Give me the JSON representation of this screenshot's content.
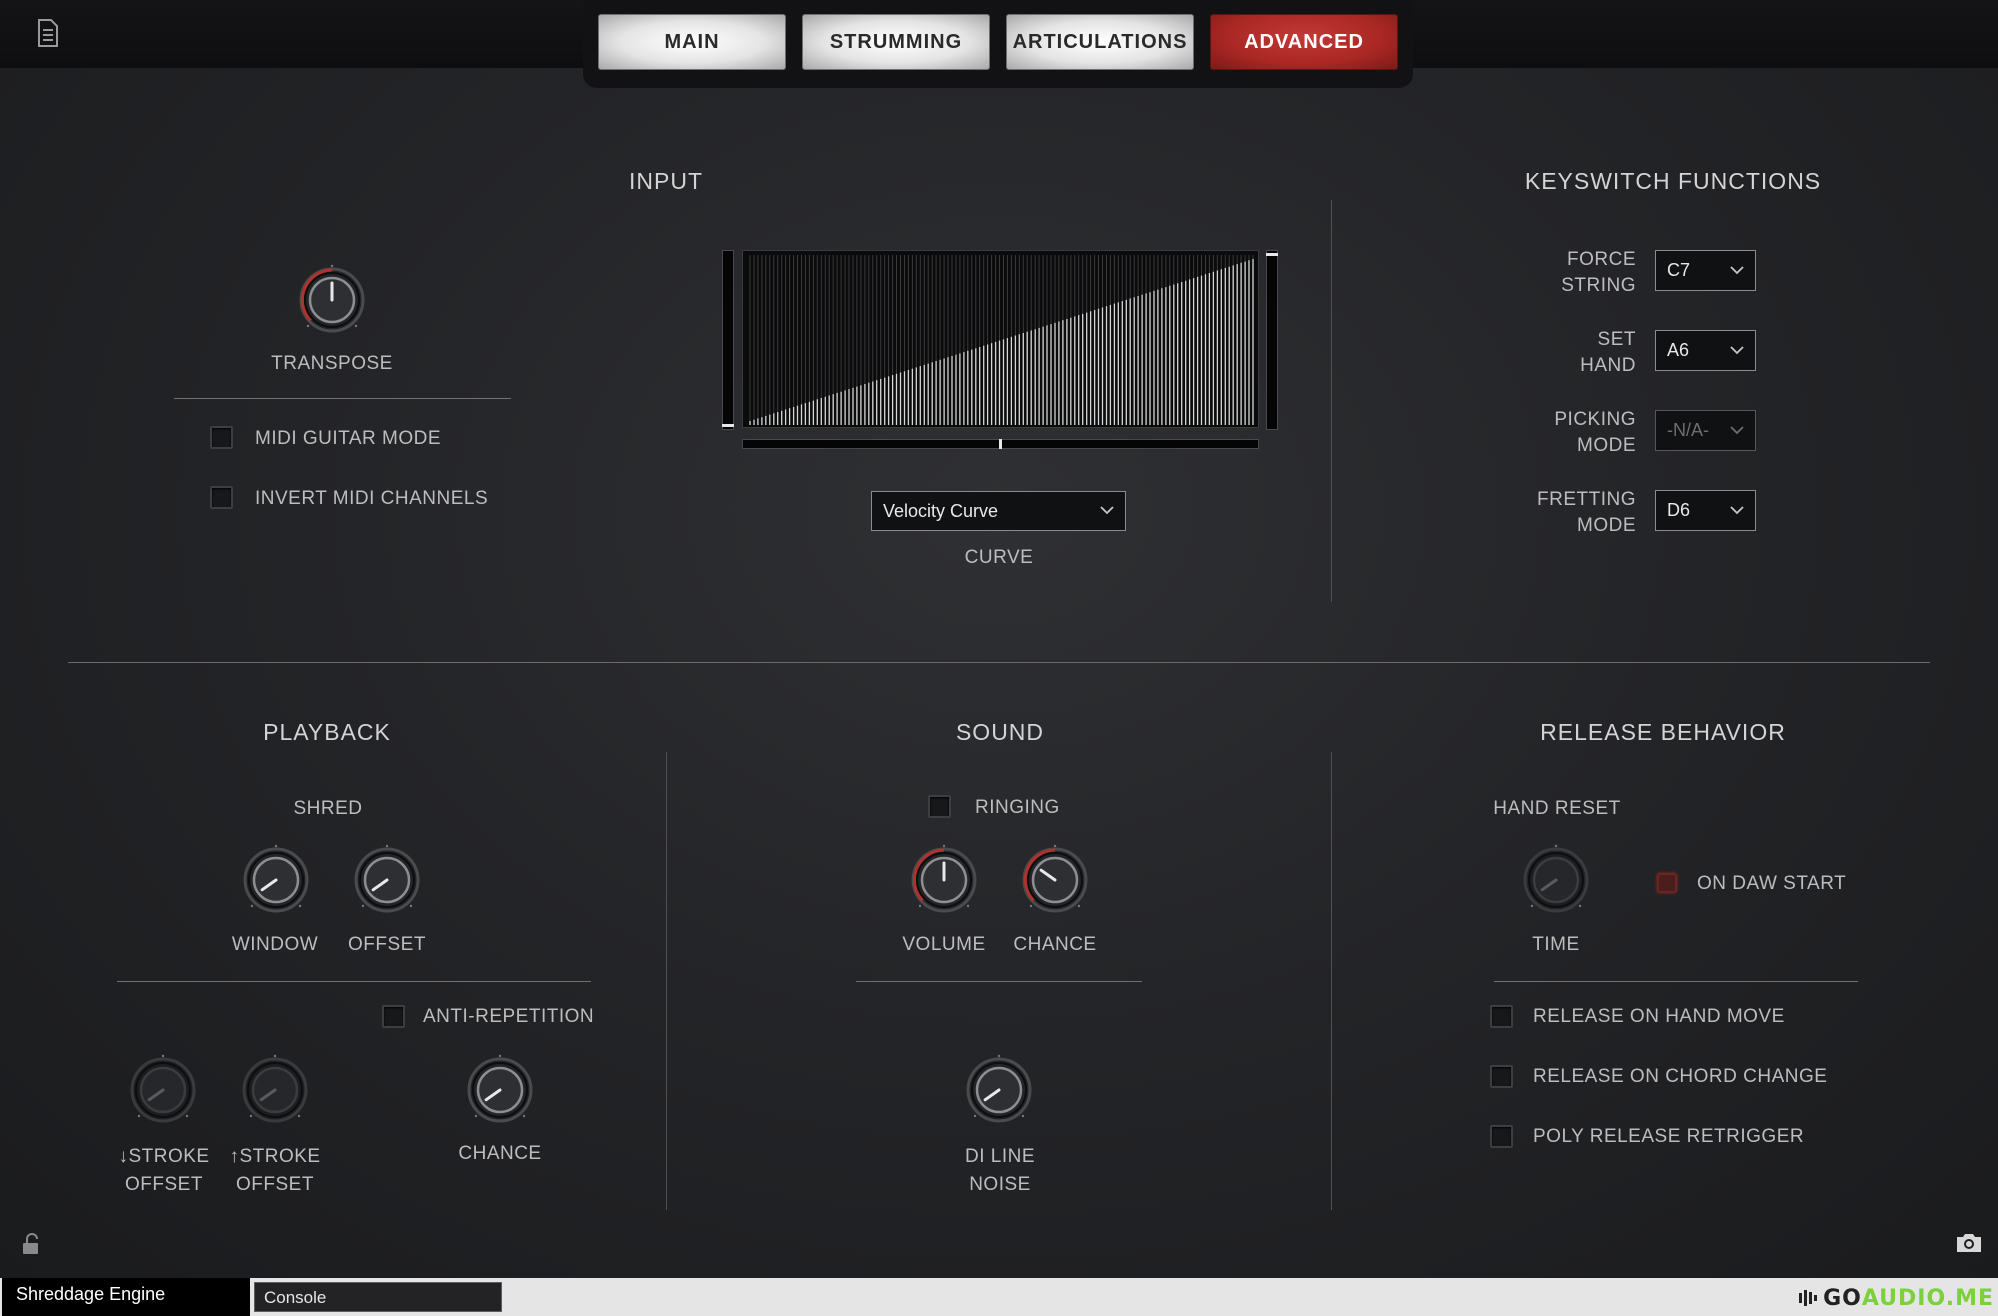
{
  "tabs": [
    {
      "label": "MAIN",
      "active": false
    },
    {
      "label": "STRUMMING",
      "active": false
    },
    {
      "label": "ARTICULATIONS",
      "active": false
    },
    {
      "label": "ADVANCED",
      "active": true
    }
  ],
  "icons": {
    "document": "document-icon",
    "lock": "unlock-icon",
    "camera": "camera-icon"
  },
  "colors": {
    "accent_red": "#b3302c",
    "indicator_red": "#8f2a27",
    "background": "#1b1c1e"
  },
  "input": {
    "title": "INPUT",
    "transpose_label": "TRANSPOSE",
    "midi_guitar_mode_label": "MIDI GUITAR MODE",
    "midi_guitar_mode_checked": false,
    "invert_midi_channels_label": "INVERT MIDI CHANNELS",
    "invert_midi_channels_checked": false,
    "curve_select_value": "Velocity Curve",
    "curve_label": "CURVE"
  },
  "keyswitch": {
    "title": "KEYSWITCH FUNCTIONS",
    "rows": [
      {
        "label_line1": "FORCE",
        "label_line2": "STRING",
        "value": "C7",
        "disabled": false
      },
      {
        "label_line1": "SET",
        "label_line2": "HAND",
        "value": "A6",
        "disabled": false
      },
      {
        "label_line1": "PICKING",
        "label_line2": "MODE",
        "value": "-N/A-",
        "disabled": true
      },
      {
        "label_line1": "FRETTING",
        "label_line2": "MODE",
        "value": "D6",
        "disabled": false
      }
    ]
  },
  "playback": {
    "title": "PLAYBACK",
    "shred_label": "SHRED",
    "window_label": "WINDOW",
    "offset_label": "OFFSET",
    "anti_repetition_label": "ANTI-REPETITION",
    "anti_repetition_checked": false,
    "down_stroke_label_1": "↓STROKE",
    "down_stroke_label_2": "OFFSET",
    "up_stroke_label_1": "↑STROKE",
    "up_stroke_label_2": "OFFSET",
    "chance_label": "CHANCE"
  },
  "sound": {
    "title": "SOUND",
    "ringing_label": "RINGING",
    "ringing_checked": false,
    "volume_label": "VOLUME",
    "chance_label": "CHANCE",
    "di_line_label_1": "DI LINE",
    "di_line_label_2": "NOISE"
  },
  "release": {
    "title": "RELEASE BEHAVIOR",
    "hand_reset_label": "HAND RESET",
    "time_label": "TIME",
    "on_daw_start_label": "ON DAW START",
    "checkboxes": [
      {
        "label": "RELEASE ON HAND MOVE",
        "checked": false
      },
      {
        "label": "RELEASE ON CHORD CHANGE",
        "checked": false
      },
      {
        "label": "POLY RELEASE RETRIGGER",
        "checked": false
      }
    ]
  },
  "statusbar": {
    "engine_tab": "Shreddage Engine",
    "console_value": "Console",
    "logo_text_1": "GO",
    "logo_text_2": "AUDIO.ME"
  }
}
